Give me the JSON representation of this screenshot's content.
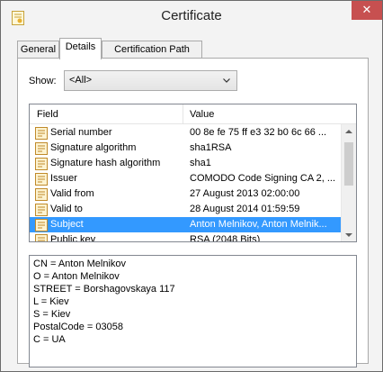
{
  "window": {
    "title": "Certificate",
    "close_glyph": "✕"
  },
  "tabs": [
    {
      "label": "General",
      "active": false
    },
    {
      "label": "Details",
      "active": true
    },
    {
      "label": "Certification Path",
      "active": false
    }
  ],
  "show": {
    "label": "Show:",
    "selected": "<All>"
  },
  "grid": {
    "columns": [
      "Field",
      "Value"
    ],
    "rows": [
      {
        "field": "Serial number",
        "value": "00 8e fe 75 ff e3 32 b0 6c 66 ...",
        "selected": false
      },
      {
        "field": "Signature algorithm",
        "value": "sha1RSA",
        "selected": false
      },
      {
        "field": "Signature hash algorithm",
        "value": "sha1",
        "selected": false
      },
      {
        "field": "Issuer",
        "value": "COMODO Code Signing CA 2, ...",
        "selected": false
      },
      {
        "field": "Valid from",
        "value": "27 August 2013 02:00:00",
        "selected": false
      },
      {
        "field": "Valid to",
        "value": "28 August 2014 01:59:59",
        "selected": false
      },
      {
        "field": "Subject",
        "value": "Anton Melnikov, Anton Melnik...",
        "selected": true
      },
      {
        "field": "Public key",
        "value": "RSA (2048 Bits)",
        "selected": false
      }
    ]
  },
  "detail_lines": [
    "CN = Anton Melnikov",
    "O = Anton Melnikov",
    "STREET = Borshagovskaya 117",
    "L = Kiev",
    "S = Kiev",
    "PostalCode = 03058",
    "C = UA"
  ],
  "colors": {
    "selection": "#3399ff",
    "close_button": "#c75050"
  }
}
